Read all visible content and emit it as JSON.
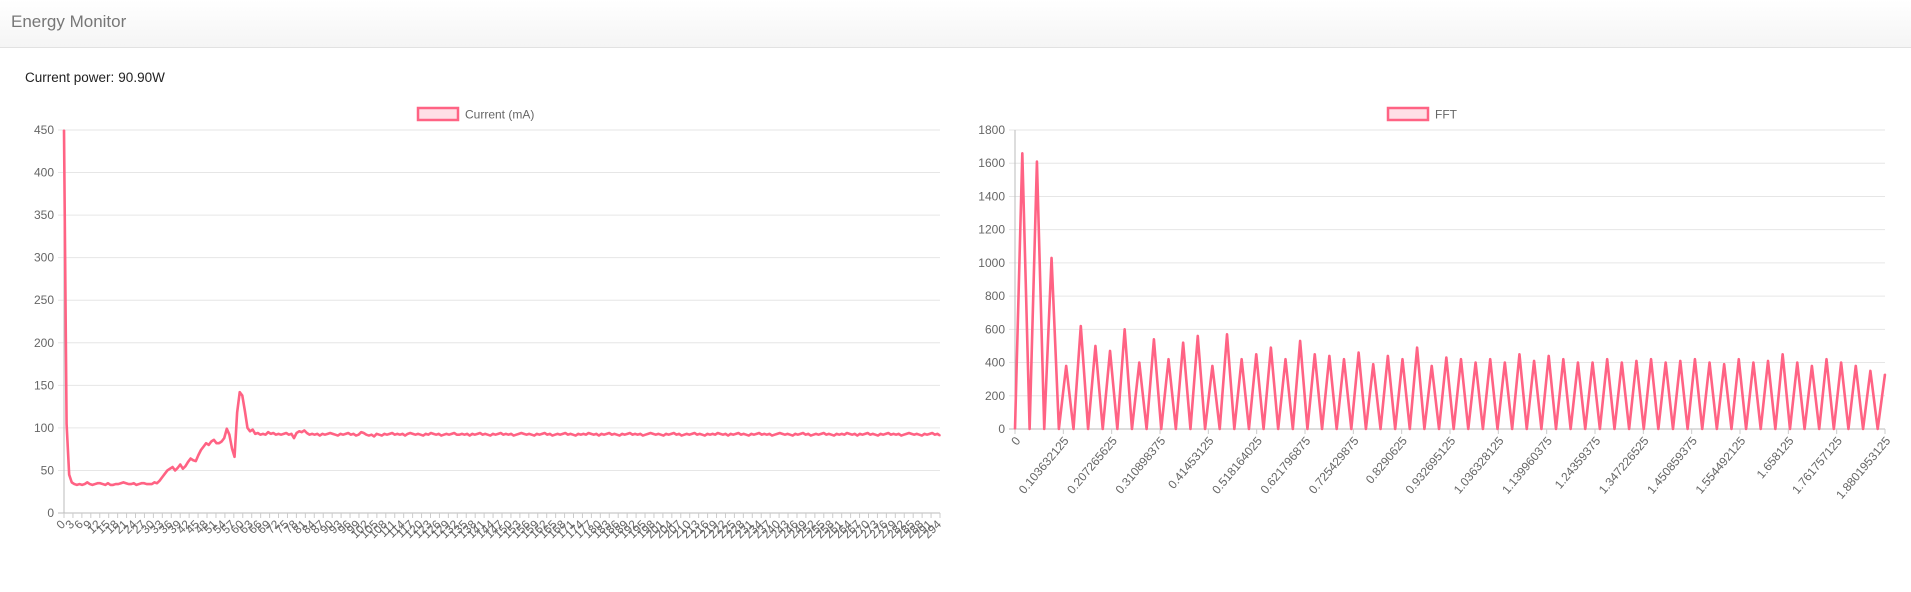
{
  "app": {
    "title": "Energy Monitor"
  },
  "status": {
    "label": "Current power:",
    "value": "90.90W"
  },
  "chart_data": [
    {
      "type": "line",
      "title": "",
      "series": [
        {
          "name": "Current (mA)",
          "color": "#ff6384",
          "values": [
            450,
            105,
            45,
            36,
            34,
            33,
            34,
            33,
            34,
            36,
            34,
            33,
            34,
            35,
            35,
            34,
            33,
            35,
            33,
            33,
            34,
            34,
            35,
            36,
            35,
            34,
            34,
            35,
            33,
            34,
            35,
            35,
            34,
            34,
            34,
            36,
            35,
            38,
            42,
            46,
            50,
            52,
            54,
            50,
            53,
            57,
            52,
            55,
            60,
            64,
            62,
            61,
            68,
            74,
            78,
            82,
            80,
            84,
            86,
            82,
            82,
            84,
            88,
            99,
            92,
            76,
            66,
            118,
            142,
            138,
            120,
            100,
            96,
            98,
            93,
            94,
            92,
            93,
            92,
            95,
            93,
            94,
            92,
            93,
            92,
            93,
            94,
            92,
            93,
            88,
            94,
            96,
            95,
            97,
            94,
            92,
            93,
            92,
            93,
            91,
            93,
            92,
            93,
            94,
            93,
            92,
            91,
            93,
            92,
            93,
            94,
            92,
            93,
            91,
            92,
            95,
            94,
            92,
            91,
            92,
            90,
            93,
            92,
            91,
            93,
            92,
            93,
            94,
            92,
            93,
            92,
            93,
            91,
            93,
            94,
            93,
            92,
            93,
            92,
            91,
            93,
            92,
            94,
            93,
            92,
            93,
            91,
            92,
            93,
            92,
            93,
            94,
            92,
            92,
            93,
            92,
            93,
            91,
            93,
            92,
            93,
            94,
            92,
            93,
            92,
            91,
            93,
            92,
            93,
            94,
            92,
            93,
            92,
            93,
            91,
            92,
            93,
            94,
            93,
            92,
            93,
            92,
            91,
            93,
            92,
            93,
            94,
            92,
            93,
            91,
            92,
            93,
            92,
            93,
            94,
            92,
            93,
            92,
            91,
            93,
            92,
            93,
            92,
            94,
            93,
            92,
            93,
            91,
            93,
            92,
            93,
            94,
            92,
            93,
            92,
            91,
            93,
            92,
            93,
            94,
            92,
            93,
            92,
            93,
            91,
            92,
            93,
            94,
            93,
            92,
            93,
            92,
            91,
            93,
            92,
            93,
            94,
            92,
            93,
            91,
            92,
            93,
            92,
            93,
            94,
            92,
            93,
            92,
            91,
            93,
            92,
            93,
            92,
            94,
            93,
            92,
            93,
            91,
            93,
            92,
            93,
            94,
            92,
            93,
            92,
            91,
            93,
            92,
            93,
            94,
            92,
            93,
            92,
            93,
            91,
            92,
            93,
            94,
            93,
            92,
            93,
            92,
            91,
            93,
            92,
            93,
            94,
            92,
            93,
            91,
            92,
            93,
            92,
            93,
            94,
            92,
            93,
            92,
            91,
            93,
            92,
            93,
            92,
            94,
            93,
            92,
            93,
            91,
            93,
            92,
            93,
            94,
            92,
            93,
            92,
            91,
            93,
            92,
            93,
            94,
            92,
            93,
            92,
            93,
            91,
            92,
            93,
            94,
            93,
            92,
            93,
            92,
            91,
            93,
            92,
            93,
            94,
            92,
            93,
            91
          ]
        }
      ],
      "x_labels": [
        "0",
        "3",
        "6",
        "9",
        "12",
        "15",
        "18",
        "21",
        "24",
        "27",
        "30",
        "33",
        "36",
        "39",
        "42",
        "45",
        "48",
        "51",
        "54",
        "57",
        "60",
        "63",
        "66",
        "69",
        "72",
        "75",
        "78",
        "81",
        "84",
        "87",
        "90",
        "93",
        "96",
        "99",
        "102",
        "105",
        "108",
        "111",
        "114",
        "117",
        "120",
        "123",
        "126",
        "129",
        "132",
        "135",
        "138",
        "141",
        "144",
        "147",
        "150",
        "153",
        "156",
        "159",
        "162",
        "165",
        "168",
        "171",
        "174",
        "177",
        "180",
        "183",
        "186",
        "189",
        "192",
        "195",
        "198",
        "201",
        "204",
        "207",
        "210",
        "213",
        "216",
        "219",
        "222",
        "225",
        "228",
        "231",
        "234",
        "237",
        "240",
        "243",
        "246",
        "249",
        "252",
        "255",
        "258",
        "261",
        "264",
        "267",
        "270",
        "273",
        "276",
        "279",
        "282",
        "285",
        "288",
        "291",
        "294"
      ],
      "y_ticks": [
        0,
        50,
        100,
        150,
        200,
        250,
        300,
        350,
        400,
        450
      ],
      "ylim": [
        0,
        450
      ],
      "legend": "top-center",
      "grid": true
    },
    {
      "type": "line",
      "title": "",
      "series": [
        {
          "name": "FFT",
          "color": "#ff6384",
          "values": [
            0,
            1660,
            0,
            1610,
            0,
            1030,
            0,
            380,
            0,
            620,
            0,
            500,
            0,
            470,
            0,
            600,
            0,
            400,
            0,
            540,
            0,
            420,
            0,
            520,
            0,
            560,
            0,
            380,
            0,
            570,
            0,
            420,
            0,
            450,
            0,
            490,
            0,
            420,
            0,
            530,
            0,
            450,
            0,
            440,
            0,
            420,
            0,
            460,
            0,
            390,
            0,
            440,
            0,
            420,
            0,
            490,
            0,
            380,
            0,
            430,
            0,
            420,
            0,
            400,
            0,
            420,
            0,
            400,
            0,
            450,
            0,
            410,
            0,
            440,
            0,
            420,
            0,
            400,
            0,
            400,
            0,
            420,
            0,
            400,
            0,
            410,
            0,
            420,
            0,
            400,
            0,
            410,
            0,
            420,
            0,
            400,
            0,
            390,
            0,
            420,
            0,
            400,
            0,
            410,
            0,
            450,
            0,
            400,
            0,
            380,
            0,
            420,
            0,
            400,
            0,
            380,
            0,
            350,
            0,
            330
          ]
        }
      ],
      "x_labels": [
        "0",
        "0.103632125",
        "0.207265625",
        "0.310898375",
        "0.41453125",
        "0.518164025",
        "0.621796875",
        "0.725429875",
        "0.8290625",
        "0.932695125",
        "1.036328125",
        "1.139960375",
        "1.24359375",
        "1.347226525",
        "1.450859375",
        "1.554492125",
        "1.658125",
        "1.761757125",
        "1.8801953125"
      ],
      "y_ticks": [
        0,
        200,
        400,
        600,
        800,
        1000,
        1200,
        1400,
        1600,
        1800
      ],
      "ylim": [
        0,
        1800
      ],
      "legend": "top-center",
      "grid": true
    }
  ]
}
